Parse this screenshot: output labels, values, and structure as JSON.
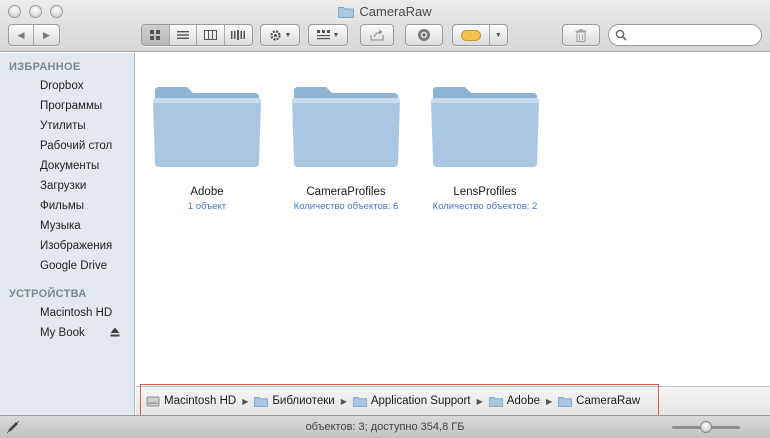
{
  "window": {
    "title": "CameraRaw"
  },
  "toolbar": {
    "back_label": "◀",
    "forward_label": "▶",
    "search_placeholder": ""
  },
  "sidebar": {
    "favorites_header": "ИЗБРАННОЕ",
    "favorites": [
      "Dropbox",
      "Программы",
      "Утилиты",
      "Рабочий стол",
      "Документы",
      "Загрузки",
      "Фильмы",
      "Музыка",
      "Изображения",
      "Google Drive"
    ],
    "devices_header": "УСТРОЙСТВА",
    "devices": [
      "Macintosh HD",
      "My Book"
    ]
  },
  "folders": [
    {
      "name": "Adobe",
      "sub": "1 объект"
    },
    {
      "name": "CameraProfiles",
      "sub": "Количество объектов: 6"
    },
    {
      "name": "LensProfiles",
      "sub": "Количество объектов: 2"
    }
  ],
  "path": [
    "Macintosh HD",
    "Библиотеки",
    "Application Support",
    "Adobe",
    "CameraRaw"
  ],
  "status": {
    "text": "объектов: 3; доступно 354,8 ГБ"
  },
  "colors": {
    "folder_blue": "#9cc0de",
    "sidebar_bg": "#e4e9ef",
    "highlight_box": "#dc5a4a",
    "tag_orange": "#f2c14e"
  }
}
